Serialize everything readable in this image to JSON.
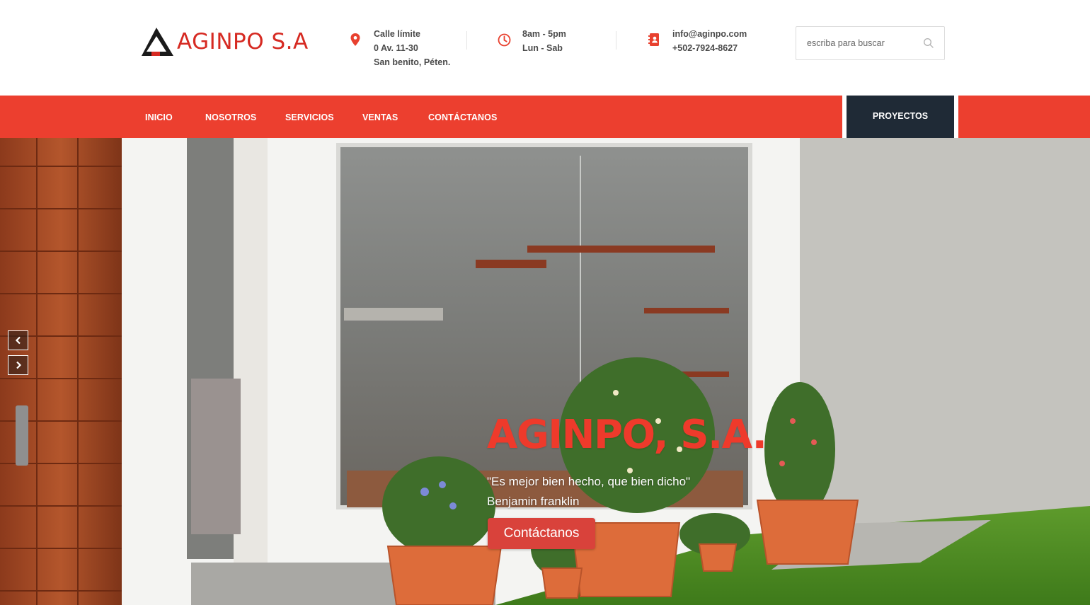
{
  "brand": {
    "logo_text": "AGINPO S.A",
    "logo_color": "#d62a22"
  },
  "header_info": {
    "address": {
      "icon": "map-pin-icon",
      "lines": [
        "Calle límite",
        "0 Av. 11-30",
        "San benito, Péten."
      ]
    },
    "hours": {
      "icon": "clock-icon",
      "lines": [
        "8am - 5pm",
        "Lun - Sab"
      ]
    },
    "contact": {
      "icon": "contact-book-icon",
      "lines": [
        "info@aginpo.com",
        "+502-7924-8627"
      ]
    }
  },
  "search": {
    "placeholder": "escriba para buscar",
    "icon": "search-icon"
  },
  "nav": {
    "items": [
      {
        "label": "INICIO"
      },
      {
        "label": "NOSOTROS"
      },
      {
        "label": "SERVICIOS"
      },
      {
        "label": "VENTAS"
      },
      {
        "label": "CONTÁCTANOS"
      }
    ],
    "cta_label": "PROYECTOS",
    "bar_color": "#ec3f2f",
    "cta_color": "#1f2a36"
  },
  "hero": {
    "title": "AGINPO, S.A.",
    "quote_line1": "\"Es mejor bien hecho, que bien dicho\"",
    "quote_line2": "Benjamin franklin",
    "button_label": "Contáctanos",
    "title_color": "#ee3a2b",
    "button_color": "#d9423b",
    "prev_icon": "chevron-left-icon",
    "next_icon": "chevron-right-icon"
  }
}
